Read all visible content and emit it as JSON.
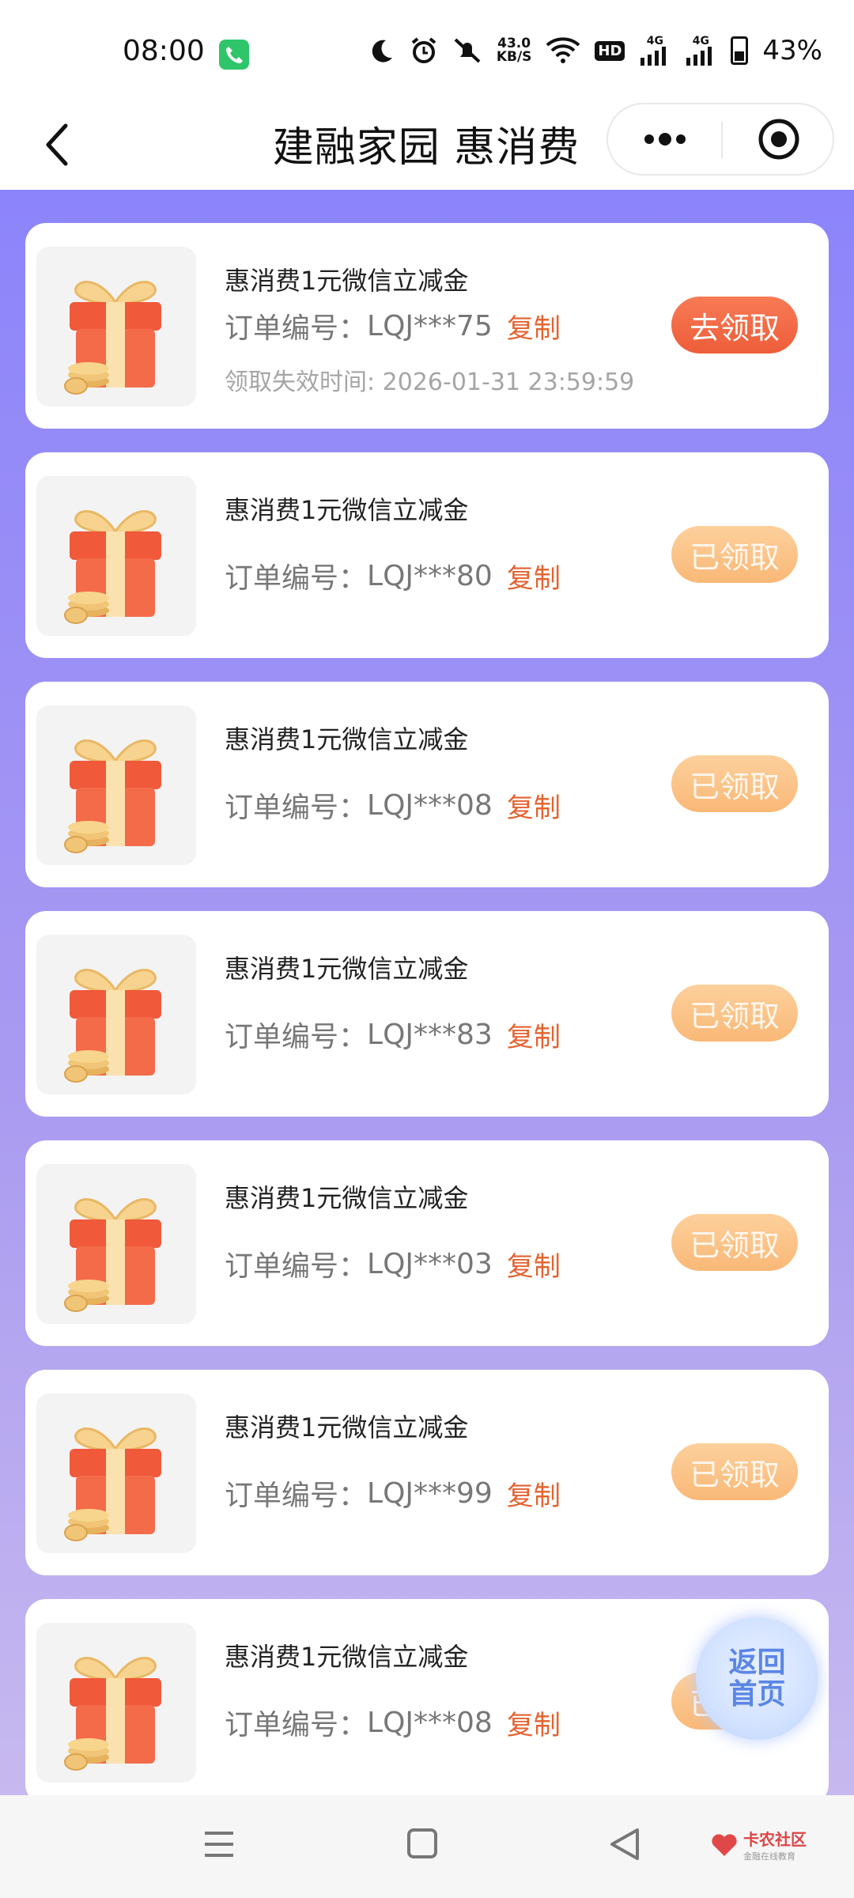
{
  "status_bar": {
    "time": "08:00",
    "net_speed_value": "43.0",
    "net_speed_unit": "KB/S",
    "hd_label": "HD",
    "signal1": "4G",
    "signal2": "4G",
    "battery_percent": "43%",
    "icons": [
      "phone-call-icon",
      "moon-icon",
      "alarm-icon",
      "mute-icon",
      "wifi-icon",
      "hd-icon",
      "signal-icon",
      "signal-icon",
      "battery-icon"
    ]
  },
  "header": {
    "title": "建融家园 惠消费",
    "icons": [
      "back-arrow-icon",
      "more-dots-icon",
      "close-target-icon"
    ]
  },
  "coupons": [
    {
      "title": "惠消费1元微信立减金",
      "order_label": "订单编号：",
      "order_no": "LQJ***75",
      "copy_label": "复制",
      "expire": "领取失效时间: 2026-01-31 23:59:59",
      "button": "去领取",
      "state": "active"
    },
    {
      "title": "惠消费1元微信立减金",
      "order_label": "订单编号：",
      "order_no": "LQJ***80",
      "copy_label": "复制",
      "expire": "",
      "button": "已领取",
      "state": "done"
    },
    {
      "title": "惠消费1元微信立减金",
      "order_label": "订单编号：",
      "order_no": "LQJ***08",
      "copy_label": "复制",
      "expire": "",
      "button": "已领取",
      "state": "done"
    },
    {
      "title": "惠消费1元微信立减金",
      "order_label": "订单编号：",
      "order_no": "LQJ***83",
      "copy_label": "复制",
      "expire": "",
      "button": "已领取",
      "state": "done"
    },
    {
      "title": "惠消费1元微信立减金",
      "order_label": "订单编号：",
      "order_no": "LQJ***03",
      "copy_label": "复制",
      "expire": "",
      "button": "已领取",
      "state": "done"
    },
    {
      "title": "惠消费1元微信立减金",
      "order_label": "订单编号：",
      "order_no": "LQJ***99",
      "copy_label": "复制",
      "expire": "",
      "button": "已领取",
      "state": "done"
    },
    {
      "title": "惠消费1元微信立减金",
      "order_label": "订单编号：",
      "order_no": "LQJ***08",
      "copy_label": "复制",
      "expire": "",
      "button": "已领取",
      "state": "done"
    }
  ],
  "home_button": {
    "line1": "返回",
    "line2": "首页"
  },
  "nav_bar": {
    "icons": [
      "menu-icon",
      "home-square-icon",
      "back-triangle-icon"
    ],
    "watermark_main": "卡农社区",
    "watermark_sub": "金融在线教育"
  },
  "colors": {
    "accent_orange": "#e5622f",
    "gradient_top": "#8c84fb",
    "gradient_bottom": "#c7b9ef",
    "claim_active": "#ee5d3a",
    "claim_done": "#f9b877"
  }
}
